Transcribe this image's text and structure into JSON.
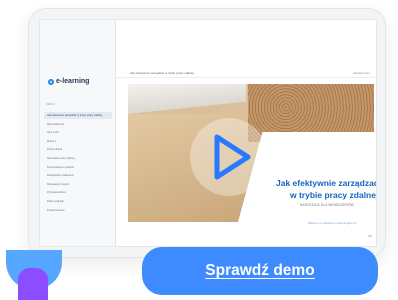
{
  "sidebar": {
    "logo_text": "e-learning",
    "section_label": "MENU",
    "items": [
      {
        "label": "Jak efektywnie zarządzać w trybie pracy zdalnej"
      },
      {
        "label": "Wprowadzenie"
      },
      {
        "label": "Spis treści"
      },
      {
        "label": "Moduł 1"
      },
      {
        "label": "Praca zdalna"
      },
      {
        "label": "Narzędzia pracy zdalnej"
      },
      {
        "label": "Komunikacja w zespole"
      },
      {
        "label": "Zarządzanie zadaniami"
      },
      {
        "label": "Motywacja zespołu"
      },
      {
        "label": "Wyzwania lidera"
      },
      {
        "label": "Dobre praktyki"
      },
      {
        "label": "Podsumowanie"
      }
    ]
  },
  "topbar": {
    "back": "‹",
    "title": "Jak efektywnie zarządzać w trybie pracy zdalnej",
    "right": "Zamknij kurs"
  },
  "video": {
    "headline_line1": "Jak efektywnie zarządzać",
    "headline_line2": "w trybie pracy zdalnej",
    "subline": "NARZĘDZIA DLA MENEDŻERÓW",
    "footer_note": "Witamy w szkoleniu e-learningowym",
    "play_icon": "play-icon"
  },
  "pager": "1/5",
  "cta": {
    "label": "Sprawdź demo"
  },
  "colors": {
    "accent": "#3d8bff",
    "headline": "#1565c0",
    "deco_blue": "#56a7ff",
    "deco_purple": "#8c4dff"
  }
}
